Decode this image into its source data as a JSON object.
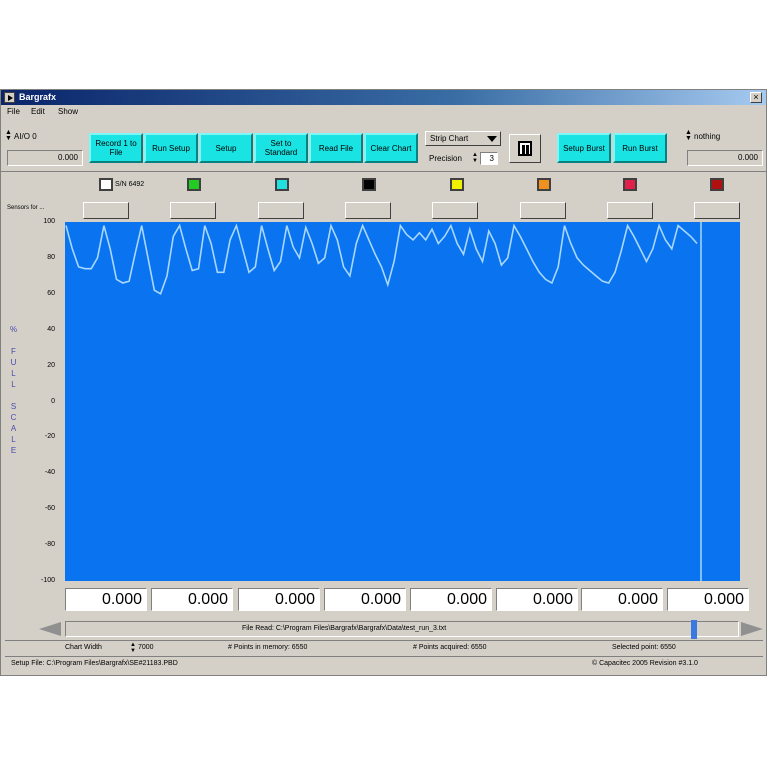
{
  "window": {
    "title": "Bargrafx",
    "close": "×"
  },
  "menu": [
    "File",
    "Edit",
    "Show"
  ],
  "left_channel": {
    "name": "AI/O 0",
    "value": "0.000"
  },
  "buttons": [
    {
      "label": "Record 1 to File"
    },
    {
      "label": "Run Setup"
    },
    {
      "label": "Setup"
    },
    {
      "label": "Set to Standard"
    },
    {
      "label": "Read File"
    },
    {
      "label": "Clear Chart"
    }
  ],
  "chart_mode": {
    "selected": "Strip Chart"
  },
  "precision": {
    "label": "Precision",
    "value": "3"
  },
  "pause_icon": "pause-icon",
  "burst_buttons": [
    {
      "label": "Setup Burst"
    },
    {
      "label": "Run Burst"
    }
  ],
  "right_channel": {
    "name": "nothing",
    "value": "0.000"
  },
  "swatch_label": "S/N 6492",
  "swatches": [
    "#ffffff",
    "#22cc22",
    "#22e0e0",
    "#000000",
    "#f0f000",
    "#f09020",
    "#e0204a",
    "#b01010"
  ],
  "sensors_label": "Sensors for ...",
  "values": [
    "0.000",
    "0.000",
    "0.000",
    "0.000",
    "0.000",
    "0.000",
    "0.000",
    "0.000"
  ],
  "status": {
    "file_read": "File Read:  C:\\Program Files\\Bargrafx\\Bargrafx\\Data\\test_run_3.txt",
    "chart_width_label": "Chart Width",
    "chart_width_value": "7000",
    "points_memory": "# Points in memory:   6550",
    "points_acquired": "# Points acquired:   6550",
    "selected_point": "Selected point:   6550",
    "setup_file": "Setup File:  C:\\Program Files\\Bargrafx\\SE#21183.PBD",
    "copyright": "© Capacitec 2005  Revision #3.1.0"
  },
  "chart_data": {
    "type": "line",
    "ylabel": "% FULL SCALE",
    "ylim": [
      -100,
      100
    ],
    "yticks": [
      "100",
      "80",
      "60",
      "40",
      "20",
      "0",
      "-20",
      "-40",
      "-60",
      "-80",
      "-100"
    ],
    "grid": false,
    "x": [
      0,
      3,
      6,
      9,
      12,
      15,
      18,
      21,
      24,
      27,
      30,
      33,
      36,
      39,
      42,
      45,
      48,
      51,
      54,
      57,
      60,
      63,
      66,
      69,
      72,
      75,
      78,
      81,
      84,
      87,
      90,
      93,
      96,
      99,
      102,
      105,
      108,
      111,
      114,
      117,
      120,
      123,
      126,
      129,
      132,
      135,
      138,
      141,
      144,
      147,
      150,
      153,
      156,
      159,
      162,
      165,
      168,
      171,
      174,
      177,
      180,
      183,
      186,
      189,
      192,
      195,
      198,
      201,
      204,
      207,
      210,
      213,
      216,
      219,
      222,
      225,
      228,
      231,
      234,
      237,
      240,
      243,
      246,
      249,
      252,
      255,
      258,
      261,
      264,
      267,
      270,
      273,
      276,
      279,
      282,
      285,
      288,
      291,
      294,
      297,
      300
    ],
    "series": [
      {
        "color": "#a8d8ff",
        "values": [
          98,
          85,
          75,
          74,
          74,
          80,
          98,
          85,
          68,
          66,
          67,
          83,
          98,
          80,
          62,
          60,
          70,
          92,
          98,
          85,
          73,
          74,
          98,
          88,
          72,
          72,
          90,
          98,
          85,
          72,
          75,
          98,
          85,
          73,
          78,
          98,
          86,
          80,
          97,
          88,
          77,
          80,
          98,
          90,
          75,
          70,
          88,
          98,
          90,
          82,
          75,
          65,
          78,
          98,
          93,
          90,
          94,
          90,
          96,
          88,
          92,
          98,
          88,
          82,
          96,
          85,
          78,
          95,
          88,
          76,
          80,
          98,
          92,
          85,
          78,
          72,
          68,
          66,
          75,
          98,
          88,
          80,
          76,
          73,
          70,
          67,
          66,
          72,
          84,
          98,
          92,
          85,
          78,
          85,
          98,
          90,
          85,
          98,
          95,
          92,
          88
        ]
      }
    ],
    "cursor_x": 300
  }
}
